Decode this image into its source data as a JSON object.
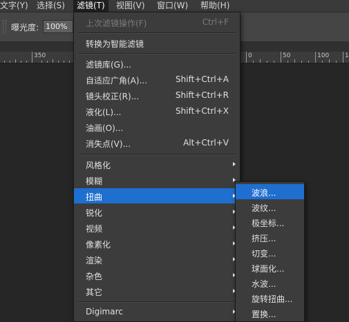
{
  "menubar": {
    "items": [
      {
        "label": "文字(Y)"
      },
      {
        "label": "选择(S)"
      },
      {
        "label": "滤镜(T)"
      },
      {
        "label": "视图(V)"
      },
      {
        "label": "窗口(W)"
      },
      {
        "label": "帮助(H)"
      }
    ]
  },
  "options": {
    "exposure_label": "曝光度:",
    "exposure_value": "100%"
  },
  "ruler": {
    "left_label": "350",
    "right_labels": [
      "0",
      "50",
      "100",
      "150"
    ]
  },
  "filter_menu": {
    "last_filter": {
      "label": "上次滤镜操作(F)",
      "shortcut": "Ctrl+F"
    },
    "smart_filter": {
      "label": "转换为智能滤镜"
    },
    "gallery": {
      "label": "滤镜库(G)..."
    },
    "adaptive_wide": {
      "label": "自适应广角(A)...",
      "shortcut": "Shift+Ctrl+A"
    },
    "lens_correction": {
      "label": "镜头校正(R)...",
      "shortcut": "Shift+Ctrl+R"
    },
    "liquify": {
      "label": "液化(L)...",
      "shortcut": "Shift+Ctrl+X"
    },
    "oil_paint": {
      "label": "油画(O)..."
    },
    "vanishing_point": {
      "label": "消失点(V)...",
      "shortcut": "Alt+Ctrl+V"
    },
    "stylize": {
      "label": "风格化"
    },
    "blur": {
      "label": "模糊"
    },
    "distort": {
      "label": "扭曲"
    },
    "sharpen": {
      "label": "锐化"
    },
    "video": {
      "label": "视频"
    },
    "pixelate": {
      "label": "像素化"
    },
    "render": {
      "label": "渲染"
    },
    "noise": {
      "label": "杂色"
    },
    "other": {
      "label": "其它"
    },
    "digimarc": {
      "label": "Digimarc"
    }
  },
  "distort_submenu": {
    "items": [
      {
        "label": "波浪..."
      },
      {
        "label": "波纹..."
      },
      {
        "label": "极坐标..."
      },
      {
        "label": "挤压..."
      },
      {
        "label": "切变..."
      },
      {
        "label": "球面化..."
      },
      {
        "label": "水波..."
      },
      {
        "label": "旋转扭曲..."
      },
      {
        "label": "置换..."
      }
    ]
  },
  "colors": {
    "highlight": "#1e6fd0",
    "menu_bg": "#3c3c3c",
    "canvas_bg": "#262626"
  }
}
